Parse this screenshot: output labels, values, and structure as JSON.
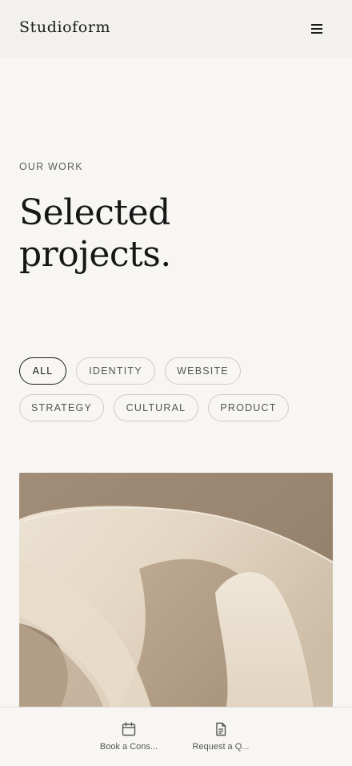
{
  "header": {
    "brand": "Studioform",
    "menu_icon": "hamburger-icon"
  },
  "hero": {
    "eyebrow": "OUR WORK",
    "title_line1": "Selected",
    "title_line2": "projects."
  },
  "filters": {
    "items": [
      {
        "label": "ALL",
        "active": true
      },
      {
        "label": "IDENTITY",
        "active": false
      },
      {
        "label": "WEBSITE",
        "active": false
      },
      {
        "label": "STRATEGY",
        "active": false
      },
      {
        "label": "CULTURAL",
        "active": false
      },
      {
        "label": "PRODUCT",
        "active": false
      }
    ]
  },
  "bottom_nav": {
    "items": [
      {
        "label": "Book a Cons...",
        "icon": "calendar-icon"
      },
      {
        "label": "Request a Q...",
        "icon": "document-icon"
      }
    ]
  },
  "colors": {
    "background": "#f7f6f3",
    "text": "#1b1b1b",
    "chip_border": "#cfccc6"
  }
}
